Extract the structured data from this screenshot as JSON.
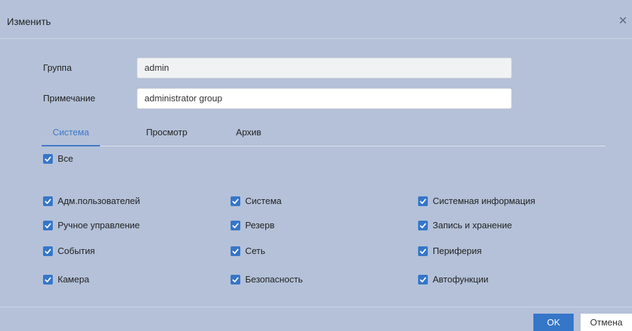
{
  "dialog": {
    "title": "Изменить",
    "close_icon": "close-icon"
  },
  "form": {
    "group_label": "Группа",
    "group_value": "admin",
    "note_label": "Примечание",
    "note_value": "administrator group"
  },
  "tabs": [
    {
      "label": "Система",
      "active": true
    },
    {
      "label": "Просмотр",
      "active": false
    },
    {
      "label": "Архив",
      "active": false
    }
  ],
  "all_checkbox": {
    "label": "Все",
    "checked": true
  },
  "permissions": {
    "col1": [
      {
        "label": "Адм.пользователей",
        "checked": true
      },
      {
        "label": "Ручное управление",
        "checked": true
      },
      {
        "label": "События",
        "checked": true
      },
      {
        "label": "Камера",
        "checked": true
      }
    ],
    "col2": [
      {
        "label": "Система",
        "checked": true
      },
      {
        "label": "Резерв",
        "checked": true
      },
      {
        "label": "Сеть",
        "checked": true
      },
      {
        "label": "Безопасность",
        "checked": true
      }
    ],
    "col3": [
      {
        "label": "Системная информация",
        "checked": true
      },
      {
        "label": "Запись и хранение",
        "checked": true
      },
      {
        "label": "Периферия",
        "checked": true
      },
      {
        "label": "Автофункции",
        "checked": true
      }
    ]
  },
  "footer": {
    "ok_label": "OK",
    "cancel_label": "Отмена"
  },
  "colors": {
    "accent": "#3576c9",
    "background": "#b4c1d8"
  }
}
